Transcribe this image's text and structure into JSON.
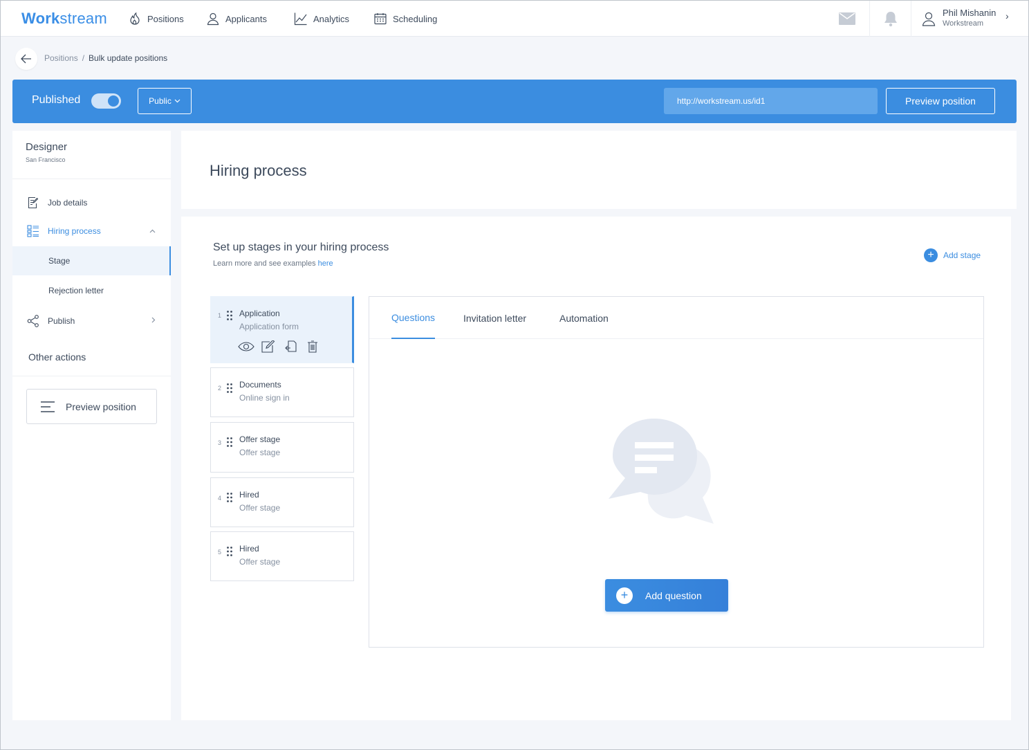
{
  "app": {
    "logo": "Workstream",
    "nav": [
      {
        "label": "Positions",
        "icon": "flame-icon"
      },
      {
        "label": "Applicants",
        "icon": "user-icon"
      },
      {
        "label": "Analytics",
        "icon": "chart-line-icon"
      },
      {
        "label": "Scheduling",
        "icon": "calendar-icon"
      }
    ],
    "user": {
      "name": "Phil Mishanin",
      "org": "Workstream"
    }
  },
  "breadcrumb": {
    "parent": "Positions",
    "separator": "/",
    "current": "Bulk update positions"
  },
  "publish_bar": {
    "status_label": "Published",
    "toggle_on": true,
    "visibility": "Public",
    "url": "http://workstream.us/id1",
    "preview_label": "Preview position"
  },
  "sidebar": {
    "title": "Designer",
    "location": "San Francisco",
    "items": [
      {
        "label": "Job details"
      },
      {
        "label": "Hiring process"
      },
      {
        "label": "Stage"
      },
      {
        "label": "Rejection letter"
      },
      {
        "label": "Publish"
      }
    ],
    "other_actions": "Other actions",
    "preview_label": "Preview position"
  },
  "header": {
    "title": "Hiring process"
  },
  "main": {
    "title": "Set up stages in your hiring process",
    "subtitle": "Learn more and see examples",
    "subtitle_link": "here",
    "add_stage": "Add stage",
    "stages": [
      {
        "num": "1",
        "name": "Application",
        "desc": "Application form"
      },
      {
        "num": "2",
        "name": "Documents",
        "desc": "Online sign in"
      },
      {
        "num": "3",
        "name": "Offer stage",
        "desc": "Offer stage"
      },
      {
        "num": "4",
        "name": "Hired",
        "desc": "Offer stage"
      },
      {
        "num": "5",
        "name": "Hired",
        "desc": "Offer stage"
      }
    ],
    "tabs": [
      "Questions",
      "Invitation letter",
      "Automation"
    ],
    "add_question": "Add question"
  },
  "colors": {
    "accent": "#3b8de0",
    "background": "#f4f6fa"
  }
}
